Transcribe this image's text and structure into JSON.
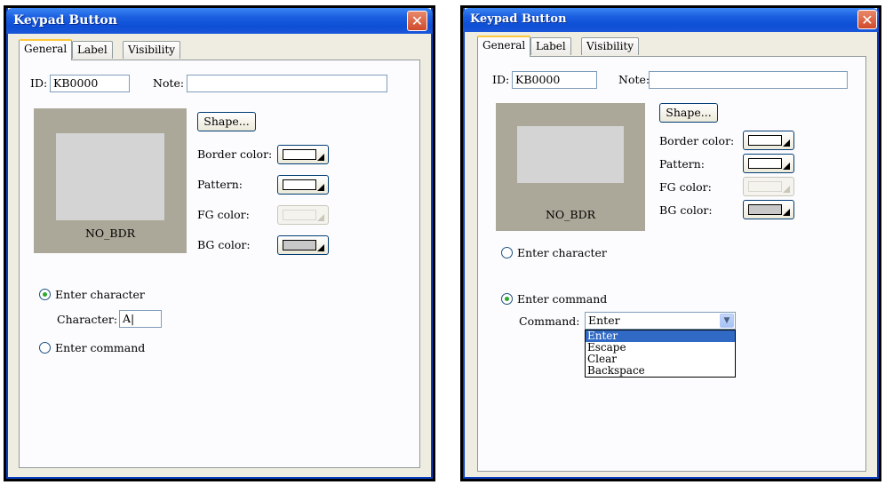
{
  "left": {
    "title": "Keypad Button",
    "close_glyph": "✕",
    "tabs": [
      {
        "label": "General"
      },
      {
        "label": "Label"
      },
      {
        "label": "Visibility"
      }
    ],
    "id_label": "ID:",
    "id_value": "KB0000",
    "note_label": "Note:",
    "note_value": "",
    "shape_button": "Shape...",
    "border_color_label": "Border color:",
    "pattern_label": "Pattern:",
    "fg_color_label": "FG color:",
    "bg_color_label": "BG color:",
    "preview_caption": "NO_BDR",
    "enter_character": "Enter character",
    "character_label": "Character:",
    "character_value": "A|",
    "enter_command": "Enter command"
  },
  "right": {
    "title": "Keypad Button",
    "close_glyph": "✕",
    "tabs": [
      {
        "label": "General"
      },
      {
        "label": "Label"
      },
      {
        "label": "Visibility"
      }
    ],
    "id_label": "ID:",
    "id_value": "KB0000",
    "note_label": "Note:",
    "note_value": "",
    "shape_button": "Shape...",
    "border_color_label": "Border color:",
    "pattern_label": "Pattern:",
    "fg_color_label": "FG color:",
    "bg_color_label": "BG color:",
    "preview_caption": "NO_BDR",
    "enter_character": "Enter character",
    "enter_command": "Enter command",
    "command_label": "Command:",
    "command_value": "Enter",
    "command_options": [
      "Enter",
      "Escape",
      "Clear",
      "Backspace"
    ],
    "command_selected": "Enter"
  },
  "colors": {
    "border_swatch": "#ffffff",
    "pattern_swatch": "#ffffff",
    "bg_swatch": "#c8c8c8",
    "preview_frame": "#aca899",
    "preview_inner": "#d4d4d4"
  }
}
